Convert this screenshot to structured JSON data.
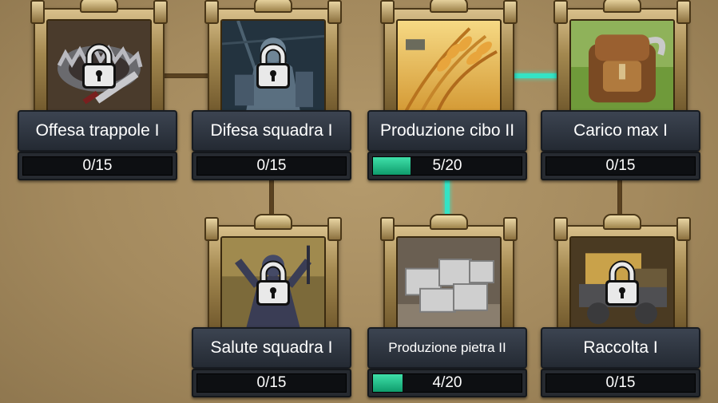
{
  "skills": [
    {
      "id": "offesa-trappole",
      "name": "Offesa trappole I",
      "progress_text": "0/15",
      "level": 0,
      "max": 15,
      "locked": true,
      "icon": "trap-icon"
    },
    {
      "id": "difesa-squadra",
      "name": "Difesa squadra I",
      "progress_text": "0/15",
      "level": 0,
      "max": 15,
      "locked": true,
      "icon": "armored-knight-icon"
    },
    {
      "id": "produzione-cibo",
      "name": "Produzione cibo II",
      "progress_text": "5/20",
      "level": 5,
      "max": 20,
      "locked": false,
      "icon": "wheat-icon"
    },
    {
      "id": "carico-max",
      "name": "Carico max I",
      "progress_text": "0/15",
      "level": 0,
      "max": 15,
      "locked": false,
      "icon": "backpack-icon"
    },
    {
      "id": "salute-squadra",
      "name": "Salute squadra I",
      "progress_text": "0/15",
      "level": 0,
      "max": 15,
      "locked": true,
      "icon": "warrior-statue-icon"
    },
    {
      "id": "produzione-pietra",
      "name": "Produzione pietra II",
      "progress_text": "4/20",
      "level": 4,
      "max": 20,
      "locked": false,
      "icon": "stone-blocks-icon"
    },
    {
      "id": "raccolta",
      "name": "Raccolta I",
      "progress_text": "0/15",
      "level": 0,
      "max": 15,
      "locked": true,
      "icon": "gathering-cart-icon"
    }
  ],
  "colors": {
    "background": "#a48a5e",
    "active_connector": "#34e3c5",
    "inactive_connector": "#5b4321",
    "progress_fill": "#1fbf85",
    "label_bg": "#2f3640"
  }
}
